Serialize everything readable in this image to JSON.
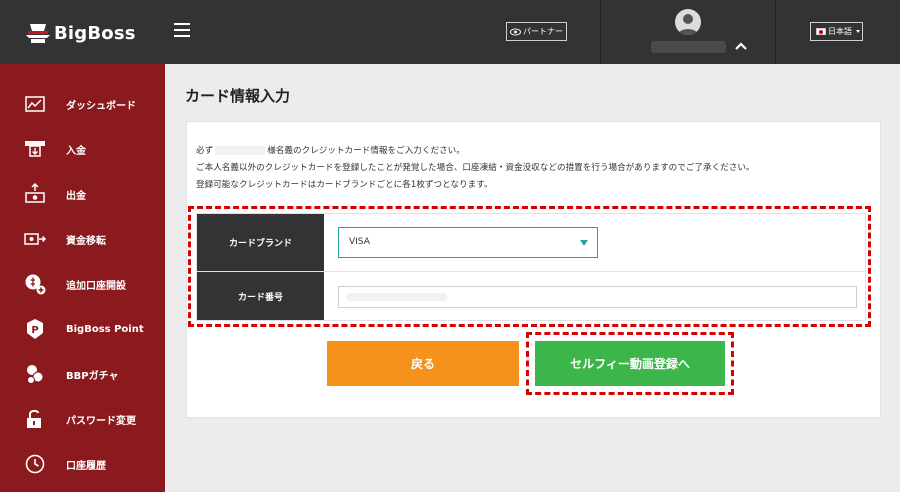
{
  "header": {
    "logo_text": "BigBoss",
    "partner_label": "パートナー",
    "language": "日本語"
  },
  "sidebar": {
    "items": [
      {
        "label": "ダッシュボード",
        "icon": "dashboard-icon"
      },
      {
        "label": "入金",
        "icon": "deposit-icon"
      },
      {
        "label": "出金",
        "icon": "withdraw-icon"
      },
      {
        "label": "資金移転",
        "icon": "transfer-icon"
      },
      {
        "label": "追加口座開設",
        "icon": "add-account-icon"
      },
      {
        "label": "BigBoss Point",
        "icon": "point-icon"
      },
      {
        "label": "BBPガチャ",
        "icon": "gacha-icon"
      },
      {
        "label": "パスワード変更",
        "icon": "lock-icon"
      },
      {
        "label": "口座履歴",
        "icon": "history-icon"
      }
    ]
  },
  "page": {
    "title": "カード情報入力",
    "notice_line1_prefix": "必ず",
    "notice_line1_suffix": "様名義のクレジットカード情報をご入力ください。",
    "notice_line2": "ご本人名義以外のクレジットカードを登録したことが発覚した場合、口座凍結・資金没収などの措置を行う場合がありますのでご了承ください。",
    "notice_line3": "登録可能なクレジットカードはカードブランドごとに各1枚ずつとなります。"
  },
  "form": {
    "brand_label": "カードブランド",
    "brand_value": "VISA",
    "number_label": "カード番号"
  },
  "buttons": {
    "back": "戻る",
    "next": "セルフィー動画登録へ"
  },
  "colors": {
    "topbar": "#333333",
    "sidebar": "#8b1a1f",
    "back_button": "#f5921e",
    "next_button": "#3cb54a",
    "highlight": "#d60000",
    "select_accent": "#2aa39a"
  }
}
